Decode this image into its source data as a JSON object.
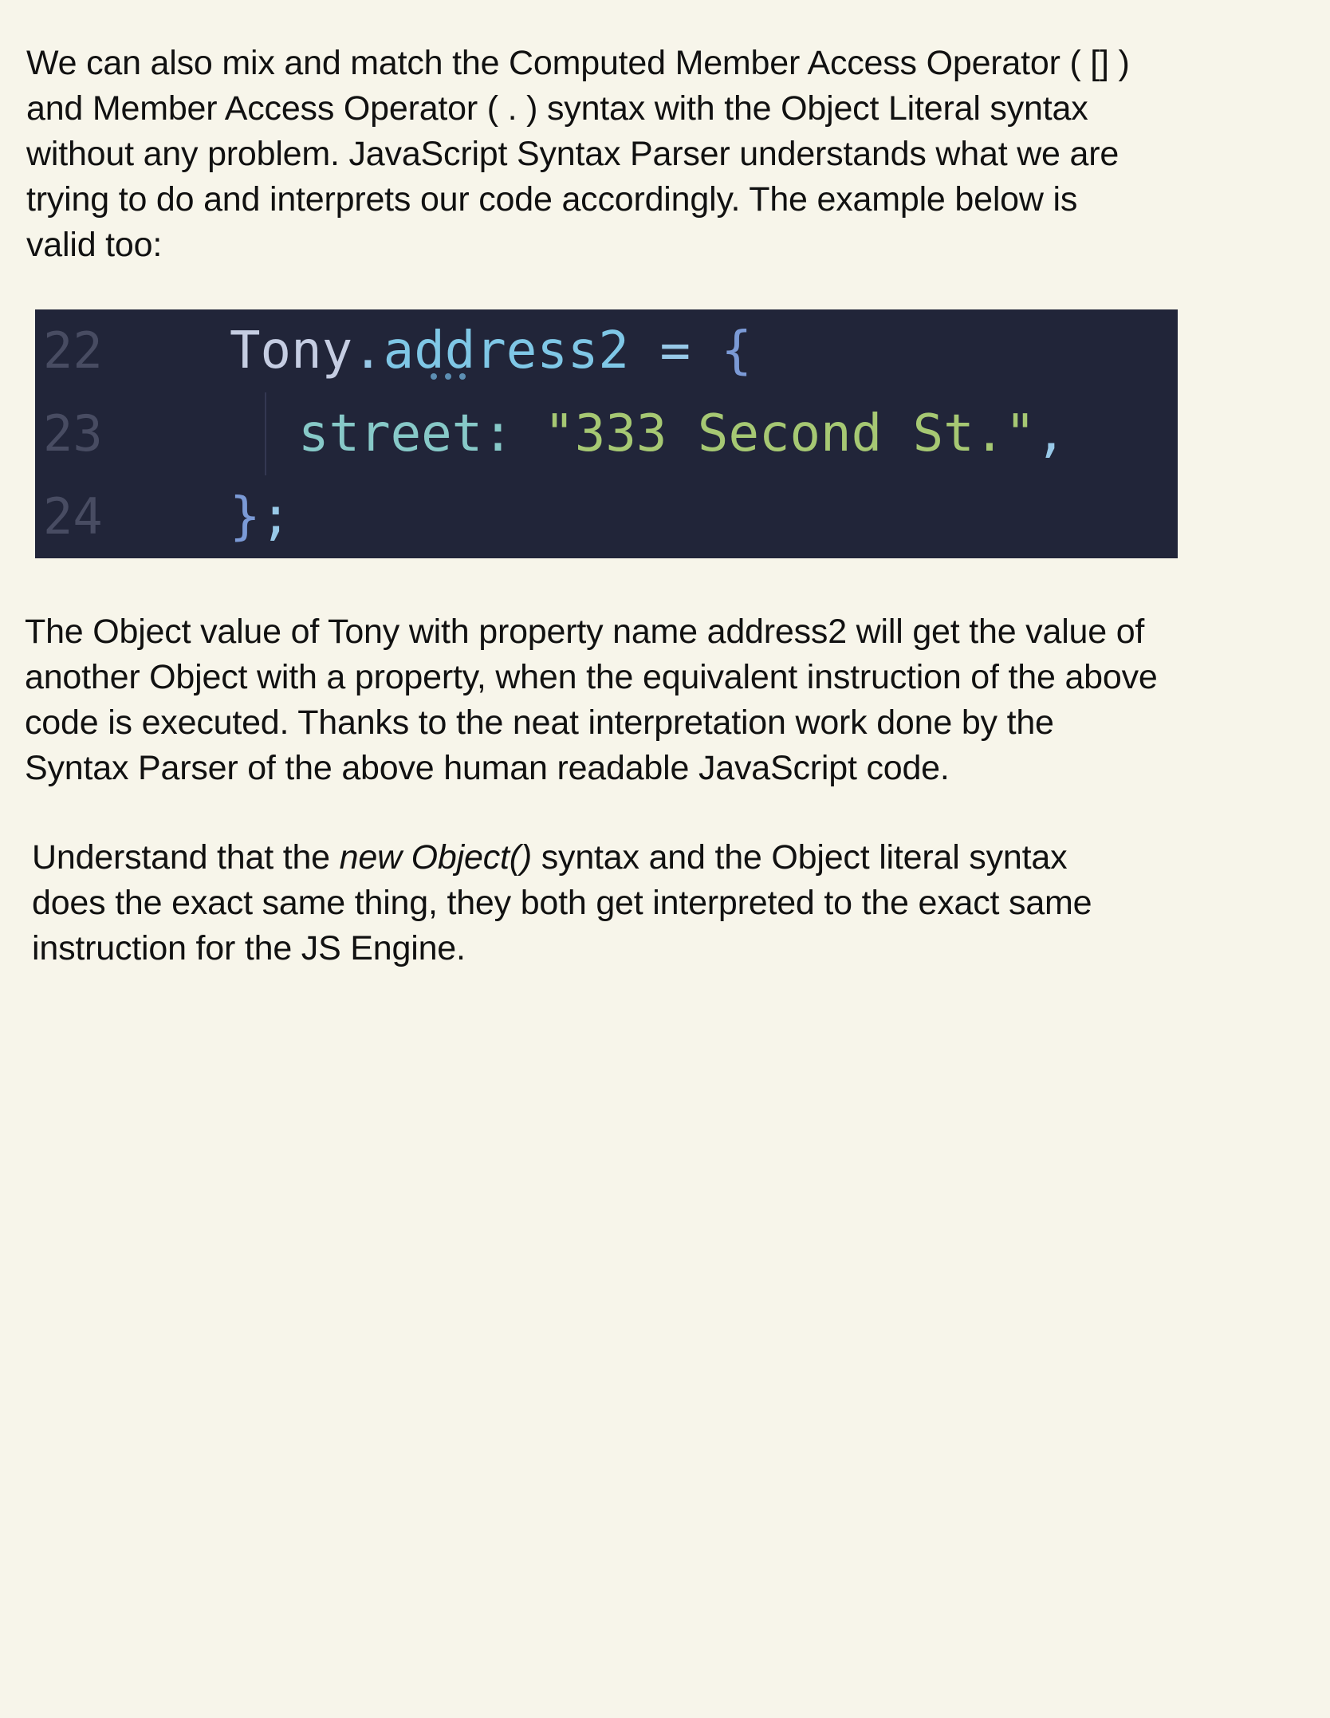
{
  "paragraphs": {
    "intro": {
      "lines": [
        "We can also mix and match the Computed Member Access Operator ( [] )",
        "and Member Access Operator ( . ) syntax with the Object Literal syntax",
        "without any problem. JavaScript Syntax Parser understands what we are",
        "trying to do and interprets our code accordingly. The example below is",
        "valid too:"
      ]
    },
    "explanation": {
      "lines": [
        "The Object value of Tony with property name address2 will get the value of",
        "another Object with a property, when the equivalent instruction of the above",
        "code is executed. Thanks to the neat interpretation work done by the",
        "Syntax Parser of the above human readable JavaScript code."
      ]
    },
    "note": {
      "line1_prefix": "Understand that the ",
      "line1_italic": "new Object()",
      "line1_suffix": " syntax and the Object literal syntax",
      "line2": "does the exact same thing, they both get interpreted to the exact same",
      "line3": "instruction for the JS Engine."
    }
  },
  "code": {
    "lines": [
      {
        "number": "22",
        "tokens": {
          "object": "Tony",
          "dot": ".",
          "property": "address2",
          "assign": " = ",
          "brace": "{"
        }
      },
      {
        "number": "23",
        "tokens": {
          "key": "street:",
          "space": " ",
          "string": "\"333 Second St.\"",
          "comma": ","
        }
      },
      {
        "number": "24",
        "tokens": {
          "brace": "}",
          "semicolon": ";"
        }
      }
    ]
  },
  "colors": {
    "page_background": "#f7f5ea",
    "code_background": "#212539",
    "line_number": "#484c62",
    "object_token": "#c5cde2",
    "property_token": "#7fc7e6",
    "string_token": "#a6c873"
  }
}
